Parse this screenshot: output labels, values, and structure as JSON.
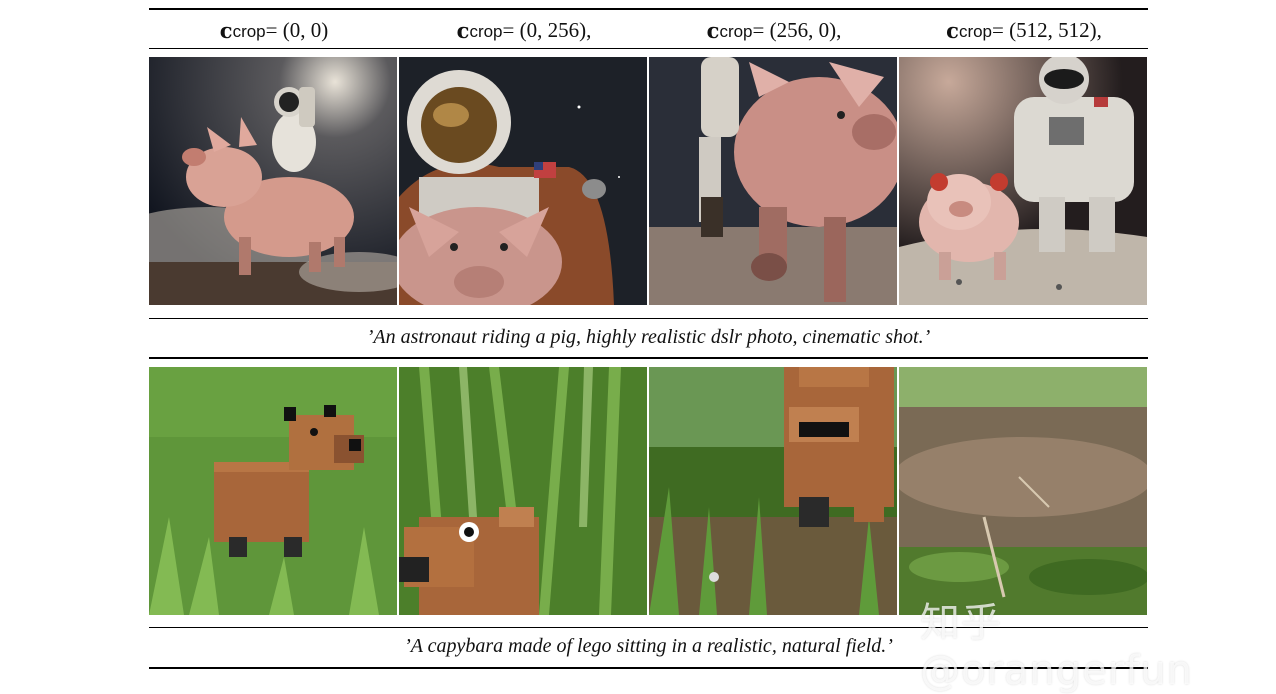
{
  "header": {
    "columns": [
      {
        "symbol": "c",
        "sub": "crop",
        "eq": " = (0, 0)"
      },
      {
        "symbol": "c",
        "sub": "crop",
        "eq": " = (0, 256),"
      },
      {
        "symbol": "c",
        "sub": "crop",
        "eq": " = (256, 0),"
      },
      {
        "symbol": "c",
        "sub": "crop",
        "eq": " = (512, 512),"
      }
    ]
  },
  "captions": {
    "row1": "’An astronaut riding a pig, highly realistic dslr photo, cinematic shot.’",
    "row2": "’A capybara made of lego sitting in a realistic, natural field.’"
  },
  "watermark": "知乎 @orangerfun",
  "colors": {
    "rule": "#000000",
    "space_bg": "#1a1c22",
    "pig": "#d89b8e",
    "suit": "#e8e4dc",
    "grass": "#4f8a2a",
    "lego": "#a8663a"
  }
}
